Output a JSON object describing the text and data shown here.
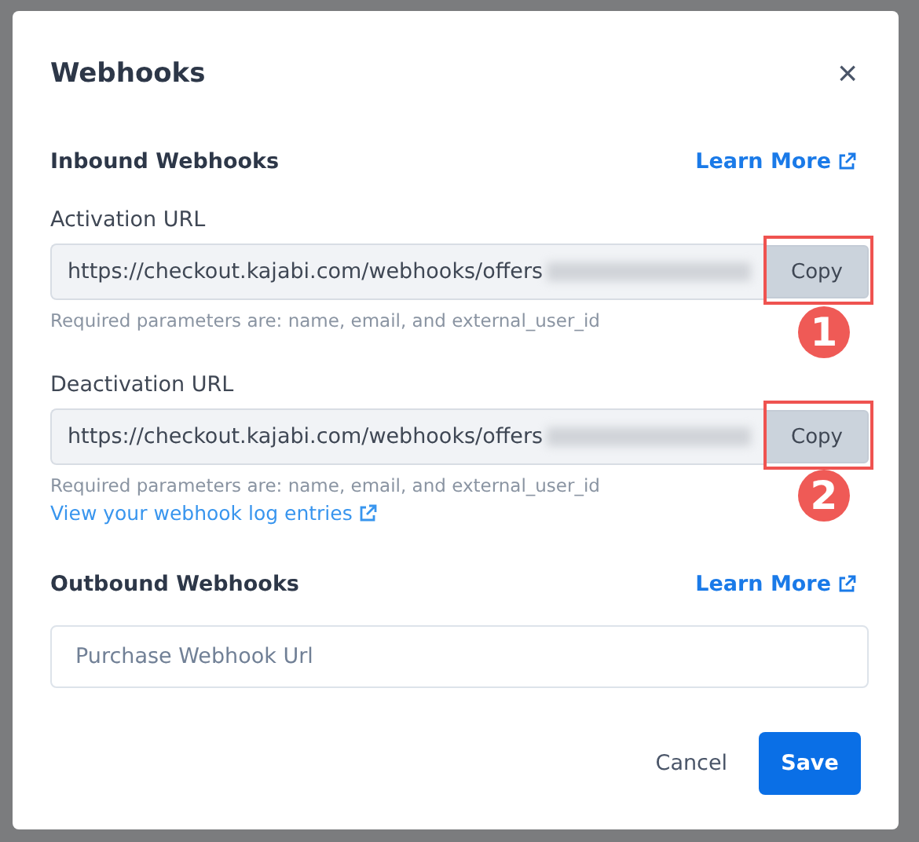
{
  "dialog": {
    "title": "Webhooks",
    "close_label": "×"
  },
  "inbound": {
    "heading": "Inbound Webhooks",
    "link": "Learn More",
    "fields": [
      {
        "label": "Activation URL",
        "value": "https://checkout.kajabi.com/webhooks/offers",
        "button": "Copy",
        "hint": "Required parameters are: name, email, and external_user_id",
        "callout": "1"
      },
      {
        "label": "Deactivation URL",
        "value": "https://checkout.kajabi.com/webhooks/offers",
        "button": "Copy",
        "hint": "Required parameters are: name, email, and external_user_id",
        "callout": "2"
      }
    ],
    "log_link": "View your webhook log entries"
  },
  "outbound": {
    "heading": "Outbound Webhooks",
    "link": "Learn More",
    "placeholder": "Purchase Webhook Url"
  },
  "buttons": {
    "cancel": "Cancel",
    "save": "Save"
  }
}
